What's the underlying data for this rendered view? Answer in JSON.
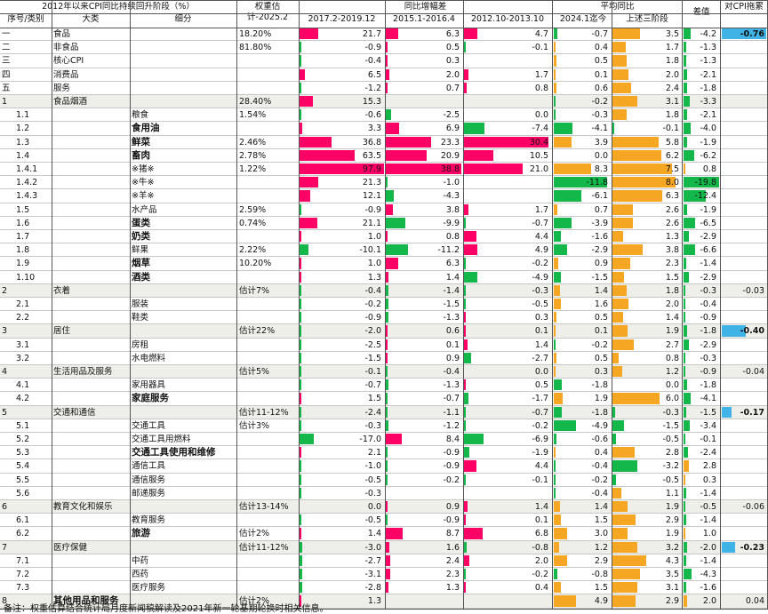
{
  "header": {
    "title": "2012年以来CPI同比持续回升阶段（%）",
    "weight_label": "权重估计-2025.2",
    "yoy_label": "同比增幅差",
    "avg_label": "平均同比",
    "diff_label": "差值",
    "drag_label": "对CPI拖累",
    "col_seq": "序号/类别",
    "col_cat": "大类",
    "col_sub": "细分",
    "period1": "2017.2-2019.12",
    "period2": "2015.1-2016.4",
    "period3": "2012.10-2013.10",
    "avg1": "2024.1迄今",
    "avg2": "上述三阶段"
  },
  "rows": [
    {
      "seq": "一",
      "cat": "食品",
      "sub": "",
      "w": "18.20%",
      "p1": "21.7",
      "p2": "6.3",
      "p3": "4.7",
      "a1": "-0.7",
      "a2": "3.5",
      "d": "-4.2",
      "drag": "-0.76",
      "sec": false,
      "bold": false
    },
    {
      "seq": "二",
      "cat": "非食品",
      "sub": "",
      "w": "81.80%",
      "p1": "-0.9",
      "p2": "0.5",
      "p3": "-0.1",
      "a1": "0.4",
      "a2": "1.7",
      "d": "-1.3",
      "drag": "",
      "sec": false,
      "bold": false
    },
    {
      "seq": "三",
      "cat": "核心CPI",
      "sub": "",
      "w": "",
      "p1": "-0.4",
      "p2": "0.3",
      "p3": "",
      "a1": "0.5",
      "a2": "1.8",
      "d": "-1.3",
      "drag": "",
      "sec": false,
      "bold": false
    },
    {
      "seq": "四",
      "cat": "消费品",
      "sub": "",
      "w": "",
      "p1": "6.5",
      "p2": "2.0",
      "p3": "1.7",
      "a1": "0.1",
      "a2": "2.0",
      "d": "-2.1",
      "drag": "",
      "sec": false,
      "bold": false
    },
    {
      "seq": "五",
      "cat": "服务",
      "sub": "",
      "w": "",
      "p1": "-1.2",
      "p2": "0.7",
      "p3": "0.8",
      "a1": "0.6",
      "a2": "2.4",
      "d": "-1.8",
      "drag": "",
      "sec": false,
      "bold": false
    },
    {
      "seq": "1",
      "cat": "食品烟酒",
      "sub": "",
      "w": "28.40%",
      "p1": "15.3",
      "p2": "",
      "p3": "",
      "a1": "-0.2",
      "a2": "3.1",
      "d": "-3.3",
      "drag": "",
      "sec": true,
      "bold": false
    },
    {
      "seq": "1.1",
      "cat": "",
      "sub": "粮食",
      "w": "1.54%",
      "p1": "-0.6",
      "p2": "-2.5",
      "p3": "0.0",
      "a1": "-0.3",
      "a2": "1.8",
      "d": "-2.1",
      "drag": "",
      "sec": false,
      "bold": false
    },
    {
      "seq": "1.2",
      "cat": "",
      "sub": "食用油",
      "w": "",
      "p1": "3.3",
      "p2": "6.9",
      "p3": "-7.4",
      "a1": "-4.1",
      "a2": "-0.1",
      "d": "-4.0",
      "drag": "",
      "sec": false,
      "bold": true
    },
    {
      "seq": "1.3",
      "cat": "",
      "sub": "鲜菜",
      "w": "2.46%",
      "p1": "36.8",
      "p2": "23.3",
      "p3": "30.4",
      "a1": "3.9",
      "a2": "5.8",
      "d": "-1.9",
      "drag": "",
      "sec": false,
      "bold": true
    },
    {
      "seq": "1.4",
      "cat": "",
      "sub": "畜肉",
      "w": "2.78%",
      "p1": "63.5",
      "p2": "20.9",
      "p3": "10.5",
      "a1": "0.0",
      "a2": "6.2",
      "d": "-6.2",
      "drag": "",
      "sec": false,
      "bold": true
    },
    {
      "seq": "1.4.1",
      "cat": "",
      "sub": "※猪※",
      "w": "1.22%",
      "p1": "97.9",
      "p2": "38.8",
      "p3": "21.0",
      "a1": "8.3",
      "a2": "7.5",
      "d": "0.8",
      "drag": "",
      "sec": false,
      "bold": false
    },
    {
      "seq": "1.4.2",
      "cat": "",
      "sub": "※牛※",
      "w": "",
      "p1": "21.3",
      "p2": "-1.0",
      "p3": "",
      "a1": "-11.8",
      "a2": "8.0",
      "d": "-19.8",
      "drag": "",
      "sec": false,
      "bold": false
    },
    {
      "seq": "1.4.3",
      "cat": "",
      "sub": "※羊※",
      "w": "",
      "p1": "12.1",
      "p2": "-4.3",
      "p3": "",
      "a1": "-6.1",
      "a2": "6.3",
      "d": "-12.4",
      "drag": "",
      "sec": false,
      "bold": false
    },
    {
      "seq": "1.5",
      "cat": "",
      "sub": "水产品",
      "w": "2.59%",
      "p1": "-0.9",
      "p2": "3.8",
      "p3": "1.7",
      "a1": "0.7",
      "a2": "2.6",
      "d": "-1.9",
      "drag": "",
      "sec": false,
      "bold": false
    },
    {
      "seq": "1.6",
      "cat": "",
      "sub": "蛋类",
      "w": "0.74%",
      "p1": "21.1",
      "p2": "-9.9",
      "p3": "-0.7",
      "a1": "-3.9",
      "a2": "2.6",
      "d": "-6.5",
      "drag": "",
      "sec": false,
      "bold": true
    },
    {
      "seq": "1.7",
      "cat": "",
      "sub": "奶类",
      "w": "",
      "p1": "1.0",
      "p2": "0.8",
      "p3": "4.4",
      "a1": "-1.6",
      "a2": "1.3",
      "d": "-2.9",
      "drag": "",
      "sec": false,
      "bold": true
    },
    {
      "seq": "1.8",
      "cat": "",
      "sub": "鲜果",
      "w": "2.22%",
      "p1": "-10.1",
      "p2": "-11.2",
      "p3": "4.9",
      "a1": "-2.9",
      "a2": "3.8",
      "d": "-6.6",
      "drag": "",
      "sec": false,
      "bold": false
    },
    {
      "seq": "1.9",
      "cat": "",
      "sub": "烟草",
      "w": "10.20%",
      "p1": "1.0",
      "p2": "6.3",
      "p3": "-0.2",
      "a1": "0.9",
      "a2": "2.3",
      "d": "-1.4",
      "drag": "",
      "sec": false,
      "bold": true
    },
    {
      "seq": "1.10",
      "cat": "",
      "sub": "酒类",
      "w": "",
      "p1": "1.3",
      "p2": "1.4",
      "p3": "-4.9",
      "a1": "-1.5",
      "a2": "1.5",
      "d": "-2.9",
      "drag": "",
      "sec": false,
      "bold": true
    },
    {
      "seq": "2",
      "cat": "衣着",
      "sub": "",
      "w": "估计7%",
      "p1": "-0.4",
      "p2": "-1.4",
      "p3": "-0.3",
      "a1": "1.4",
      "a2": "1.8",
      "d": "-0.3",
      "drag": "-0.03",
      "sec": true,
      "bold": false
    },
    {
      "seq": "2.1",
      "cat": "",
      "sub": "服装",
      "w": "",
      "p1": "-0.2",
      "p2": "-1.5",
      "p3": "-0.5",
      "a1": "1.6",
      "a2": "2.0",
      "d": "-0.4",
      "drag": "",
      "sec": false,
      "bold": false
    },
    {
      "seq": "2.2",
      "cat": "",
      "sub": "鞋类",
      "w": "",
      "p1": "-0.9",
      "p2": "-1.3",
      "p3": "0.3",
      "a1": "0.5",
      "a2": "1.4",
      "d": "-0.9",
      "drag": "",
      "sec": false,
      "bold": false
    },
    {
      "seq": "3",
      "cat": "居住",
      "sub": "",
      "w": "估计22%",
      "p1": "-2.0",
      "p2": "0.6",
      "p3": "0.1",
      "a1": "0.1",
      "a2": "1.9",
      "d": "-1.8",
      "drag": "-0.40",
      "sec": true,
      "bold": false
    },
    {
      "seq": "3.1",
      "cat": "",
      "sub": "房租",
      "w": "",
      "p1": "-2.5",
      "p2": "0.1",
      "p3": "1.4",
      "a1": "-0.2",
      "a2": "2.7",
      "d": "-2.9",
      "drag": "",
      "sec": false,
      "bold": false
    },
    {
      "seq": "3.2",
      "cat": "",
      "sub": "水电燃料",
      "w": "",
      "p1": "-1.5",
      "p2": "0.9",
      "p3": "-2.7",
      "a1": "0.5",
      "a2": "0.8",
      "d": "-0.3",
      "drag": "",
      "sec": false,
      "bold": false
    },
    {
      "seq": "4",
      "cat": "生活用品及服务",
      "sub": "",
      "w": "估计5%",
      "p1": "-0.1",
      "p2": "-0.4",
      "p3": "0.0",
      "a1": "0.3",
      "a2": "1.2",
      "d": "-0.9",
      "drag": "-0.04",
      "sec": true,
      "bold": false
    },
    {
      "seq": "4.1",
      "cat": "",
      "sub": "家用器具",
      "w": "",
      "p1": "-0.7",
      "p2": "-1.3",
      "p3": "0.5",
      "a1": "-1.8",
      "a2": "0.0",
      "d": "-1.8",
      "drag": "",
      "sec": false,
      "bold": false
    },
    {
      "seq": "4.2",
      "cat": "",
      "sub": "家庭服务",
      "w": "",
      "p1": "1.5",
      "p2": "-0.7",
      "p3": "-1.7",
      "a1": "1.9",
      "a2": "6.0",
      "d": "-4.1",
      "drag": "",
      "sec": false,
      "bold": true
    },
    {
      "seq": "5",
      "cat": "交通和通信",
      "sub": "",
      "w": "估计11-12%",
      "p1": "-2.4",
      "p2": "-1.1",
      "p3": "-0.7",
      "a1": "-1.8",
      "a2": "-0.3",
      "d": "-1.5",
      "drag": "-0.17",
      "sec": true,
      "bold": false
    },
    {
      "seq": "5.1",
      "cat": "",
      "sub": "交通工具",
      "w": "估计3%",
      "p1": "-0.3",
      "p2": "-1.2",
      "p3": "-0.2",
      "a1": "-4.9",
      "a2": "-1.5",
      "d": "-3.4",
      "drag": "",
      "sec": false,
      "bold": false
    },
    {
      "seq": "5.2",
      "cat": "",
      "sub": "交通工具用燃料",
      "w": "",
      "p1": "-17.0",
      "p2": "8.4",
      "p3": "-6.9",
      "a1": "-0.6",
      "a2": "-0.5",
      "d": "-0.1",
      "drag": "",
      "sec": false,
      "bold": false
    },
    {
      "seq": "5.3",
      "cat": "",
      "sub": "交通工具使用和维修",
      "w": "",
      "p1": "2.1",
      "p2": "-0.9",
      "p3": "-1.9",
      "a1": "0.4",
      "a2": "2.8",
      "d": "-2.4",
      "drag": "",
      "sec": false,
      "bold": true
    },
    {
      "seq": "5.4",
      "cat": "",
      "sub": "通信工具",
      "w": "",
      "p1": "-1.0",
      "p2": "-0.9",
      "p3": "4.4",
      "a1": "-0.4",
      "a2": "-3.2",
      "d": "2.8",
      "drag": "",
      "sec": false,
      "bold": false
    },
    {
      "seq": "5.5",
      "cat": "",
      "sub": "通信服务",
      "w": "",
      "p1": "-0.5",
      "p2": "-0.2",
      "p3": "-0.1",
      "a1": "-0.2",
      "a2": "-0.5",
      "d": "0.3",
      "drag": "",
      "sec": false,
      "bold": false
    },
    {
      "seq": "5.6",
      "cat": "",
      "sub": "邮递服务",
      "w": "",
      "p1": "-0.3",
      "p2": "",
      "p3": "",
      "a1": "-0.4",
      "a2": "1.1",
      "d": "-1.4",
      "drag": "",
      "sec": false,
      "bold": false
    },
    {
      "seq": "6",
      "cat": "教育文化和娱乐",
      "sub": "",
      "w": "估计13-14%",
      "p1": "0.0",
      "p2": "0.9",
      "p3": "1.4",
      "a1": "1.4",
      "a2": "1.9",
      "d": "-0.5",
      "drag": "-0.06",
      "sec": true,
      "bold": false
    },
    {
      "seq": "6.1",
      "cat": "",
      "sub": "教育服务",
      "w": "",
      "p1": "-0.5",
      "p2": "-0.9",
      "p3": "0.1",
      "a1": "1.5",
      "a2": "2.9",
      "d": "-1.4",
      "drag": "",
      "sec": false,
      "bold": false
    },
    {
      "seq": "6.2",
      "cat": "",
      "sub": "旅游",
      "w": "估计2%",
      "p1": "1.4",
      "p2": "8.7",
      "p3": "6.8",
      "a1": "3.0",
      "a2": "1.9",
      "d": "1.0",
      "drag": "",
      "sec": false,
      "bold": true
    },
    {
      "seq": "7",
      "cat": "医疗保健",
      "sub": "",
      "w": "估计11-12%",
      "p1": "-3.0",
      "p2": "1.6",
      "p3": "-0.8",
      "a1": "1.2",
      "a2": "3.2",
      "d": "-2.0",
      "drag": "-0.23",
      "sec": true,
      "bold": false
    },
    {
      "seq": "7.1",
      "cat": "",
      "sub": "中药",
      "w": "",
      "p1": "-2.7",
      "p2": "2.4",
      "p3": "2.0",
      "a1": "2.9",
      "a2": "4.3",
      "d": "-1.4",
      "drag": "",
      "sec": false,
      "bold": false
    },
    {
      "seq": "7.2",
      "cat": "",
      "sub": "西药",
      "w": "",
      "p1": "-3.1",
      "p2": "2.3",
      "p3": "-0.2",
      "a1": "-0.8",
      "a2": "3.5",
      "d": "-4.3",
      "drag": "",
      "sec": false,
      "bold": false
    },
    {
      "seq": "7.3",
      "cat": "",
      "sub": "医疗服务",
      "w": "",
      "p1": "-2.8",
      "p2": "1.3",
      "p3": "0.4",
      "a1": "1.5",
      "a2": "3.1",
      "d": "-1.6",
      "drag": "",
      "sec": false,
      "bold": false
    },
    {
      "seq": "8",
      "cat": "其他用品和服务",
      "sub": "",
      "w": "估计2%",
      "p1": "1.3",
      "p2": "",
      "p3": "",
      "a1": "4.9",
      "a2": "2.9",
      "d": "2.0",
      "drag": "0.04",
      "sec": true,
      "bold": true
    }
  ],
  "note": "备注：权重估算结合统计局月度新闻稿解读及2021年新一轮基期轮换时相关信息。",
  "colors": {
    "positive": "#ff0066",
    "negative": "#14b84a",
    "avg": "#f5a623",
    "drag": "#3fb3e6"
  }
}
